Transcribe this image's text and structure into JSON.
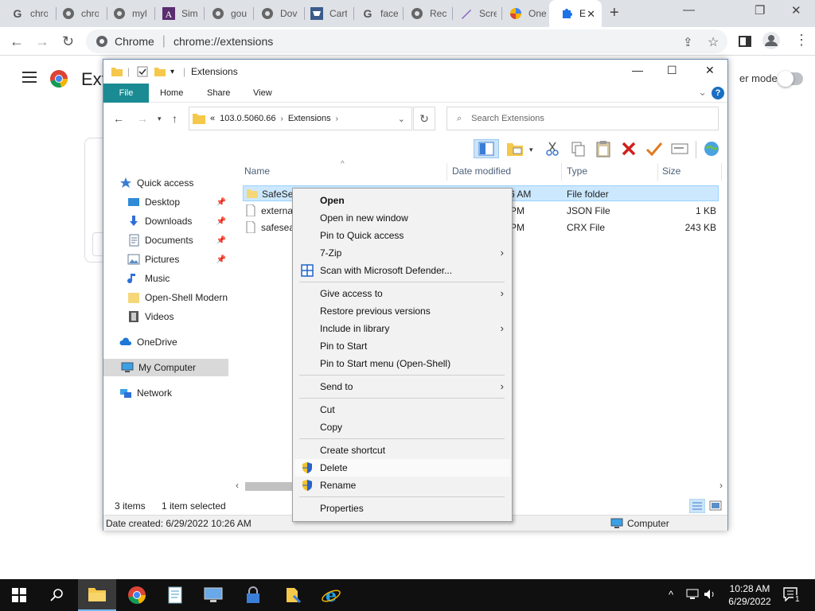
{
  "browser": {
    "tabs": [
      {
        "title": "chro",
        "icon": "google-g-icon"
      },
      {
        "title": "chro",
        "icon": "globe-icon"
      },
      {
        "title": "myl",
        "icon": "globe-icon"
      },
      {
        "title": "Sim",
        "icon": "sim-logo-icon"
      },
      {
        "title": "gou",
        "icon": "globe-icon"
      },
      {
        "title": "Dov",
        "icon": "globe-icon"
      },
      {
        "title": "Cart",
        "icon": "cart-icon"
      },
      {
        "title": "face",
        "icon": "google-g-icon"
      },
      {
        "title": "Rec",
        "icon": "globe-icon"
      },
      {
        "title": "Scre",
        "icon": "pen-icon"
      },
      {
        "title": "One",
        "icon": "onedrive-color-icon"
      },
      {
        "title": "E",
        "icon": "puzzle-icon"
      }
    ],
    "omnibox_site": "Chrome",
    "omnibox_url": "chrome://extensions"
  },
  "extensions_page": {
    "title": "Ext",
    "devmode_label": "er mode"
  },
  "explorer": {
    "title": "Extensions",
    "ribbon_tabs": [
      "File",
      "Home",
      "Share",
      "View"
    ],
    "address": {
      "prefix": "«",
      "parts": [
        "103.0.5060.66",
        "Extensions"
      ]
    },
    "search_placeholder": "Search Extensions",
    "nav": {
      "quick_access": "Quick access",
      "items": [
        {
          "label": "Desktop",
          "pinned": true
        },
        {
          "label": "Downloads",
          "pinned": true
        },
        {
          "label": "Documents",
          "pinned": true
        },
        {
          "label": "Pictures",
          "pinned": true
        },
        {
          "label": "Music",
          "pinned": false
        },
        {
          "label": "Open-Shell Modern",
          "pinned": false
        },
        {
          "label": "Videos",
          "pinned": false
        }
      ],
      "onedrive": "OneDrive",
      "my_computer": "My Computer",
      "network": "Network"
    },
    "columns": {
      "name": "Name",
      "date": "Date modified",
      "type": "Type",
      "size": "Size"
    },
    "files": [
      {
        "name": "SafeSea",
        "date": "6 AM",
        "type": "File folder",
        "size": ""
      },
      {
        "name": "externa",
        "date": "PM",
        "type": "JSON File",
        "size": "1 KB"
      },
      {
        "name": "safesea",
        "date": "PM",
        "type": "CRX File",
        "size": "243 KB"
      }
    ],
    "status_items": "3 items",
    "status_selected": "1 item selected",
    "details": "Date created: 6/29/2022 10:26 AM",
    "details_location": "Computer"
  },
  "context_menu": {
    "open": "Open",
    "open_new_window": "Open in new window",
    "pin_quick_access": "Pin to Quick access",
    "seven_zip": "7-Zip",
    "scan_defender": "Scan with Microsoft Defender...",
    "give_access": "Give access to",
    "restore_versions": "Restore previous versions",
    "include_library": "Include in library",
    "pin_start": "Pin to Start",
    "pin_start_openshell": "Pin to Start menu (Open-Shell)",
    "send_to": "Send to",
    "cut": "Cut",
    "copy": "Copy",
    "create_shortcut": "Create shortcut",
    "delete": "Delete",
    "rename": "Rename",
    "properties": "Properties"
  },
  "taskbar": {
    "time": "10:28 AM",
    "date": "6/29/2022",
    "notification_count": "1"
  },
  "colors": {
    "ribbon_file_tab": "#1a8b93",
    "selection": "#cce8ff",
    "taskbar": "#101010"
  }
}
